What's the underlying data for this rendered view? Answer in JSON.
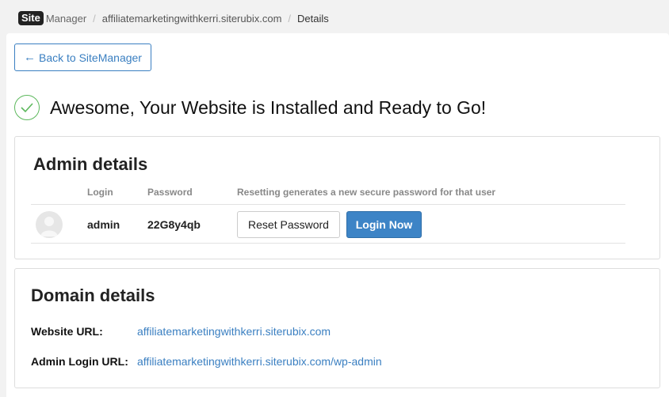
{
  "breadcrumb": {
    "logo_site": "Site",
    "logo_manager": "Manager",
    "domain": "affiliatemarketingwithkerri.siterubix.com",
    "current": "Details",
    "separator": "/"
  },
  "back_button": {
    "label": "Back to SiteManager"
  },
  "success": {
    "title": "Awesome, Your Website is Installed and Ready to Go!"
  },
  "admin": {
    "title": "Admin details",
    "headers": {
      "login": "Login",
      "password": "Password",
      "note": "Resetting generates a new secure password for that user"
    },
    "row": {
      "login": "admin",
      "password": "22G8y4qb"
    },
    "reset_label": "Reset Password",
    "login_label": "Login Now"
  },
  "domain": {
    "title": "Domain details",
    "website_label": "Website URL:",
    "website_url": "affiliatemarketingwithkerri.siterubix.com",
    "admin_label": "Admin Login URL:",
    "admin_url": "affiliatemarketingwithkerri.siterubix.com/wp-admin"
  },
  "colors": {
    "accent": "#3a7fc1",
    "success": "#5cb85c",
    "primary_button": "#3d84c6"
  },
  "icons": {
    "back": "arrow-left-icon",
    "success": "check-circle-icon",
    "avatar": "user-avatar-icon"
  }
}
